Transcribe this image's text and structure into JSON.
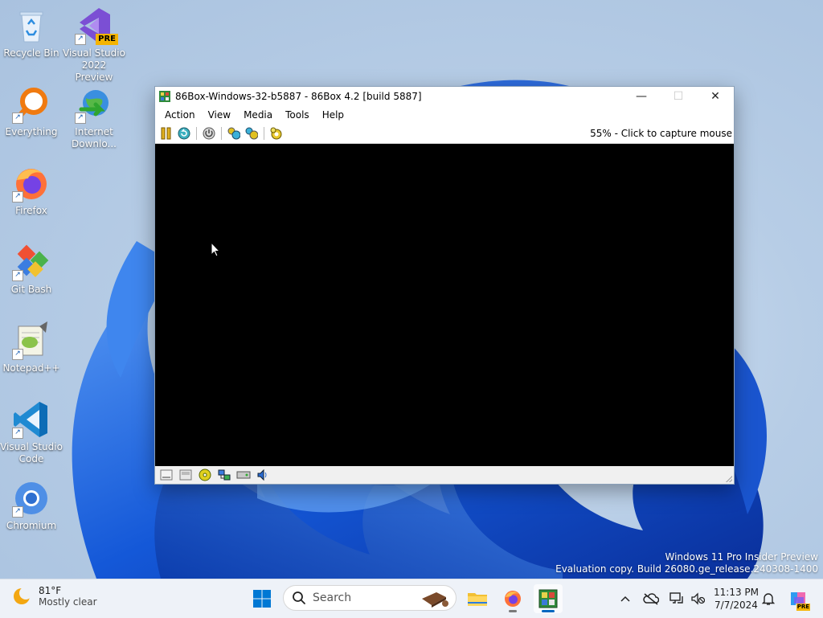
{
  "desktop": {
    "icons": [
      {
        "label": "Recycle Bin"
      },
      {
        "label": "Visual Studio 2022 Preview",
        "badge": "PRE"
      },
      {
        "label": "Everything"
      },
      {
        "label": "Internet Downlo..."
      },
      {
        "label": "Firefox"
      },
      {
        "label": "Git Bash"
      },
      {
        "label": "Notepad++"
      },
      {
        "label": "Visual Studio Code"
      },
      {
        "label": "Chromium"
      }
    ],
    "watermark": {
      "line1": "Windows 11 Pro Insider Preview",
      "line2": "Evaluation copy. Build 26080.ge_release.240308-1400"
    }
  },
  "window": {
    "title": "86Box-Windows-32-b5887 - 86Box 4.2 [build 5887]",
    "controls": {
      "minimize": "—",
      "maximize": "☐",
      "close": "✕"
    },
    "menu": [
      "Action",
      "View",
      "Media",
      "Tools",
      "Help"
    ],
    "toolbar_status": "55% - Click to capture mouse",
    "toolbar_icons": [
      "pause-icon",
      "reset-icon",
      "power-icon",
      "ctrl-alt-del-icon",
      "ctrl-alt-esc-icon",
      "settings-icon"
    ],
    "status_icons": [
      "floppy-drive-1-icon",
      "floppy-drive-2-icon",
      "cdrom-icon",
      "network-icon",
      "hard-disk-icon",
      "sound-icon"
    ]
  },
  "taskbar": {
    "weather": {
      "temp": "81°F",
      "condition": "Mostly clear"
    },
    "search_placeholder": "Search",
    "clock": {
      "time": "11:13 PM",
      "date": "7/7/2024"
    },
    "copilot_badge": "PRE"
  },
  "colors": {
    "accent": "#0067c0",
    "bloom_dark": "#0a3fb8",
    "bloom_light": "#2f7bf0"
  }
}
